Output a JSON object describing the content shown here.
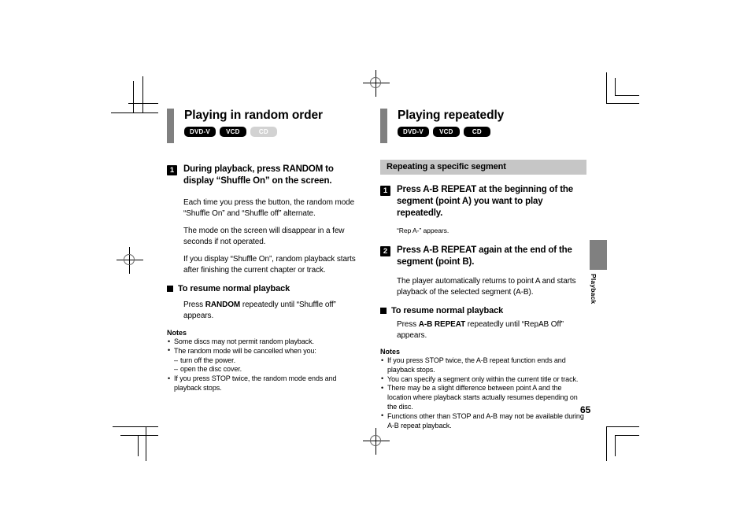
{
  "page": {
    "number": "65",
    "side_tab_label": "Playback"
  },
  "left_column": {
    "title": "Playing in random order",
    "badges": [
      {
        "label": "DVD-V",
        "enabled": true
      },
      {
        "label": "VCD",
        "enabled": true
      },
      {
        "label": "CD",
        "enabled": false
      }
    ],
    "step": {
      "number": "1",
      "text": "During playback, press RANDOM to display “Shuffle On” on the screen."
    },
    "paragraphs": [
      "Each time you press the button, the random mode “Shuffle On” and “Shuffle off” alternate.",
      "The mode on the screen will disappear in a few seconds if not operated.",
      "If you display “Shuffle On”, random playback starts after finishing the current chapter or track."
    ],
    "subhead": "To resume normal playback",
    "subhead_body_pre": "Press ",
    "subhead_body_bold": "RANDOM",
    "subhead_body_post": " repeatedly until “Shuffle off” appears.",
    "notes_label": "Notes",
    "notes": [
      {
        "text": "Some discs may not permit random playback."
      },
      {
        "text": "The random mode will be cancelled when you:",
        "sub": [
          "turn off the power.",
          "open the disc cover."
        ]
      },
      {
        "text": "If you press STOP twice, the random mode ends and playback stops."
      }
    ]
  },
  "right_column": {
    "title": "Playing repeatedly",
    "badges": [
      {
        "label": "DVD-V",
        "enabled": true
      },
      {
        "label": "VCD",
        "enabled": true
      },
      {
        "label": "CD",
        "enabled": true
      }
    ],
    "section_bar": "Repeating a specific segment",
    "step1": {
      "number": "1",
      "text": "Press A-B REPEAT at the beginning of the segment (point A) you want to play repeatedly.",
      "note": "“Rep A-” appears."
    },
    "step2": {
      "number": "2",
      "text": "Press A-B REPEAT again at the end of the segment (point B).",
      "note": "The player automatically returns to point A and starts playback of the selected segment (A-B)."
    },
    "subhead": "To resume normal playback",
    "subhead_body_pre": "Press ",
    "subhead_body_bold": "A-B REPEAT",
    "subhead_body_post": " repeatedly until “RepAB Off” appears.",
    "notes_label": "Notes",
    "notes": [
      {
        "text": "If you press STOP twice, the A-B repeat function ends and playback stops."
      },
      {
        "text": "You can specify a segment only within the current title or track."
      },
      {
        "text": "There may be a slight difference between point A and the location where playback starts actually resumes depending on the disc."
      },
      {
        "text": "Functions other than STOP and A-B may not be available during A-B repeat playback."
      }
    ]
  },
  "colors": {
    "accent_bar": "#808080",
    "section_bar": "#c6c6c6",
    "badge_on": "#000000",
    "badge_off": "#d2d2d2"
  }
}
